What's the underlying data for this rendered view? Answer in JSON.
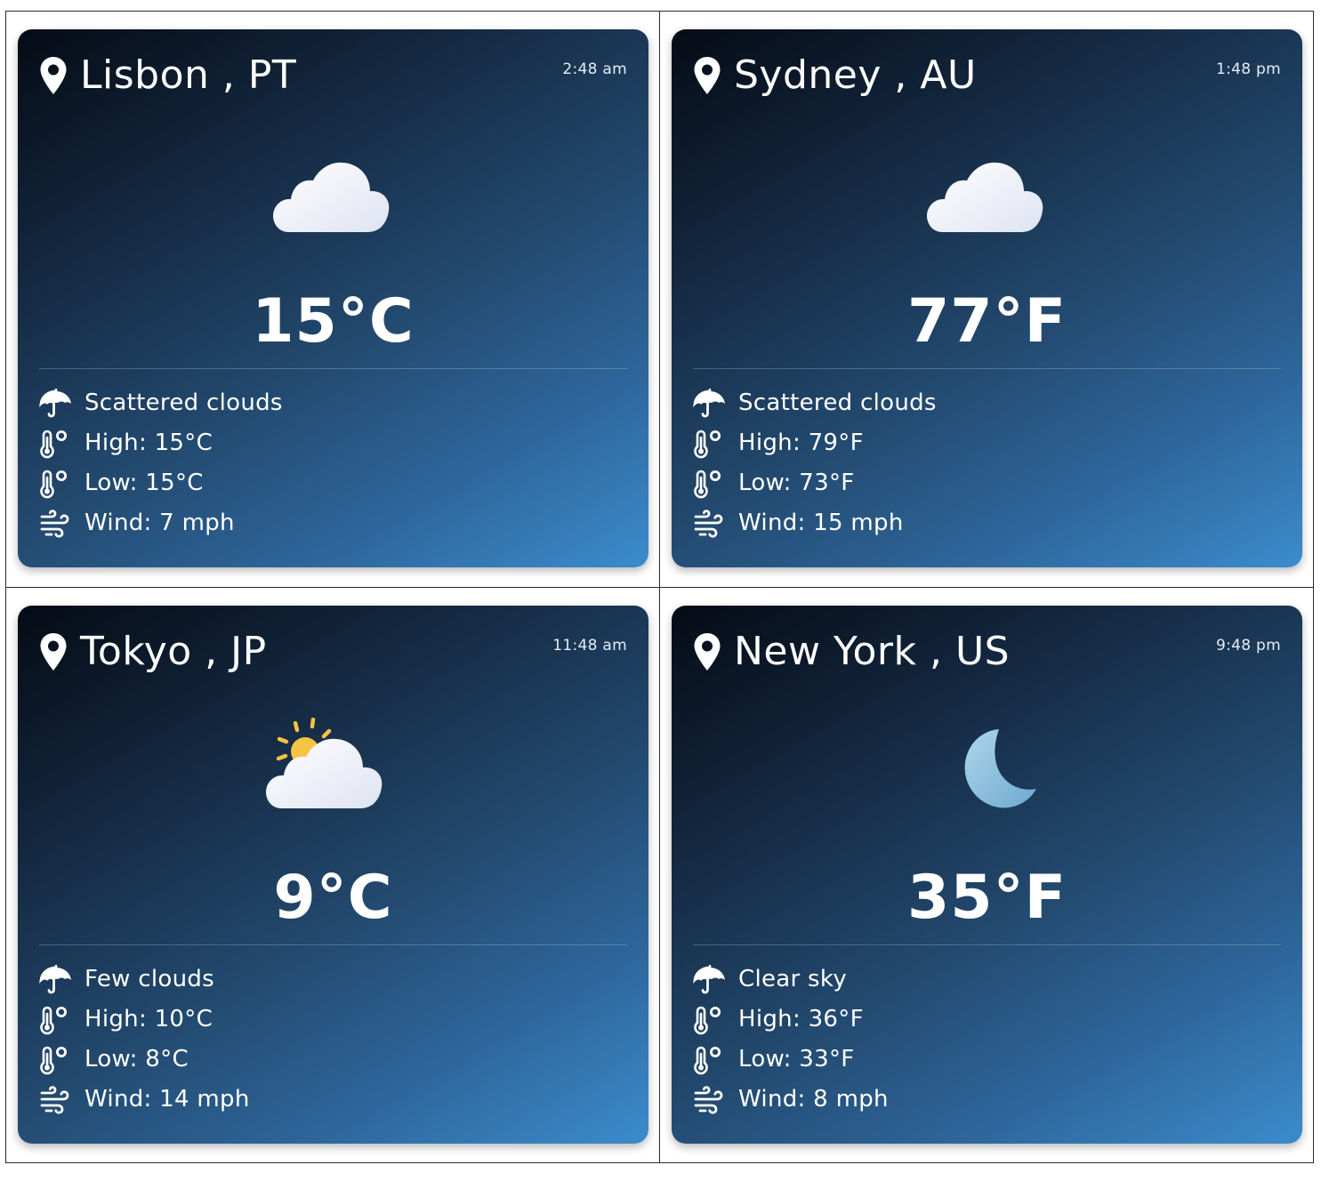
{
  "cards": [
    {
      "city": "Lisbon , PT",
      "time": "2:48 am",
      "temperature": "15°C",
      "condition": "Scattered clouds",
      "high": "High: 15°C",
      "low": "Low: 15°C",
      "wind": "Wind: 7 mph",
      "icon": "cloud-icon"
    },
    {
      "city": "Sydney , AU",
      "time": "1:48 pm",
      "temperature": "77°F",
      "condition": "Scattered clouds",
      "high": "High: 79°F",
      "low": "Low: 73°F",
      "wind": "Wind: 15 mph",
      "icon": "cloud-icon"
    },
    {
      "city": "Tokyo , JP",
      "time": "11:48 am",
      "temperature": "9°C",
      "condition": "Few clouds",
      "high": "High: 10°C",
      "low": "Low: 8°C",
      "wind": "Wind: 14 mph",
      "icon": "sun-cloud-icon"
    },
    {
      "city": "New York , US",
      "time": "9:48 pm",
      "temperature": "35°F",
      "condition": "Clear sky",
      "high": "High: 36°F",
      "low": "Low: 33°F",
      "wind": "Wind: 8 mph",
      "icon": "moon-icon"
    }
  ],
  "colors": {
    "card_gradient_start": "#050b15",
    "card_gradient_end": "#3b8ccd",
    "cloud": "#f3f5fc",
    "sun": "#f7c343",
    "moon": "#8fc3e0"
  }
}
